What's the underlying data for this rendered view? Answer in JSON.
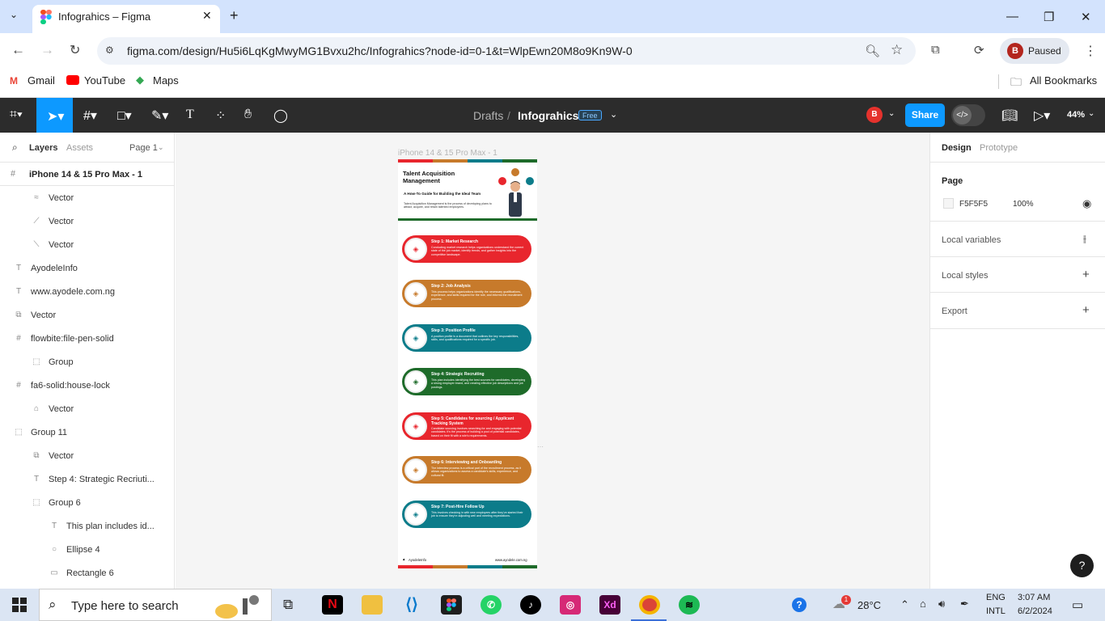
{
  "browser": {
    "tab_title": "Infograhics – Figma",
    "new_tab": "+",
    "url": "figma.com/design/Hu5i6LqKgMwyMG1Bvxu2hc/Infograhics?node-id=0-1&t=WlpEwn20M8o9Kn9W-0",
    "profile_initial": "B",
    "profile_status": "Paused",
    "bookmarks": [
      "Gmail",
      "YouTube",
      "Maps"
    ],
    "all_bookmarks": "All Bookmarks"
  },
  "figma": {
    "breadcrumb_drafts": "Drafts",
    "breadcrumb_sep": "/",
    "file_name": "Infograhics",
    "plan_badge": "Free",
    "user_initial": "B",
    "share_label": "Share",
    "zoom": "44%",
    "left_tabs": {
      "layers": "Layers",
      "assets": "Assets",
      "page": "Page 1"
    },
    "frame_name": "iPhone 14 & 15 Pro Max - 1",
    "layers": [
      {
        "name": "Vector",
        "icon": "≈",
        "indent": 2
      },
      {
        "name": "Vector",
        "icon": "⟋",
        "indent": 2
      },
      {
        "name": "Vector",
        "icon": "⟍",
        "indent": 2
      },
      {
        "name": "AyodeleInfo",
        "icon": "T",
        "indent": 1
      },
      {
        "name": "www.ayodele.com.ng",
        "icon": "T",
        "indent": 1
      },
      {
        "name": "Vector",
        "icon": "⧉",
        "indent": 1
      },
      {
        "name": "flowbite:file-pen-solid",
        "icon": "#",
        "indent": 1
      },
      {
        "name": "Group",
        "icon": "⬚",
        "indent": 2
      },
      {
        "name": "fa6-solid:house-lock",
        "icon": "#",
        "indent": 1
      },
      {
        "name": "Vector",
        "icon": "⌂",
        "indent": 2
      },
      {
        "name": "Group 11",
        "icon": "⬚",
        "indent": 1
      },
      {
        "name": "Vector",
        "icon": "⧉",
        "indent": 2
      },
      {
        "name": "Step 4: Strategic Recriuti...",
        "icon": "T",
        "indent": 2
      },
      {
        "name": "Group 6",
        "icon": "⬚",
        "indent": 2
      },
      {
        "name": "This plan includes id...",
        "icon": "T",
        "indent": 3
      },
      {
        "name": "Ellipse 4",
        "icon": "○",
        "indent": 3
      },
      {
        "name": "Rectangle 6",
        "icon": "▭",
        "indent": 3
      }
    ],
    "right_tabs": {
      "design": "Design",
      "prototype": "Prototype"
    },
    "page_section": "Page",
    "page_color": "F5F5F5",
    "page_opacity": "100%",
    "local_variables": "Local variables",
    "local_styles": "Local styles",
    "export": "Export",
    "help": "?"
  },
  "infographic": {
    "frame_label": "iPhone 14 & 15 Pro Max - 1",
    "title": "Talent Acquisition Management",
    "subtitle": "A How-To Guide for Building the Ideal Team",
    "intro": "Talent Acquisition Management is the process of developing plans to attract, acquire, and retain talented employees.",
    "footer_brand": "AyodeleInfo",
    "footer_url": "www.ayodele.com.ng",
    "steps": [
      {
        "title": "Step 1: Market Research",
        "desc": "Conducting market research helps organizations understand the current state of the job market, identify trends, and gather insights into the competitive landscape.",
        "color": "#e8262d"
      },
      {
        "title": "Step 2: Job Analysis",
        "desc": "This process helps organizations identify the necessary qualifications, experience, and skills required for the role, and informs the recruitment process.",
        "color": "#c77a2b"
      },
      {
        "title": "Step 3: Position Profile",
        "desc": "A position profile is a document that outlines the key responsibilities, skills, and qualifications required for a specific job.",
        "color": "#0c7c8a"
      },
      {
        "title": "Step 4: Strategic Recruiting",
        "desc": "This plan includes identifying the best sources for candidates, developing a strong employer brand, and creating effective job descriptions and job postings.",
        "color": "#1e6b2a"
      },
      {
        "title": "Step 5: Candidates for sourcing / Applicant Tracking System",
        "desc": "Candidate sourcing involves searching for and engaging with potential candidates. It's the process of building a pool of potential candidates, based on their fit with a role's requirements.",
        "color": "#e8262d"
      },
      {
        "title": "Step 6: Interviewing and Onboarding",
        "desc": "The interview process is a critical part of the recruitment process, as it allows organizations to assess a candidate's skills, experience, and cultural fit.",
        "color": "#c77a2b"
      },
      {
        "title": "Step 7: Post-Hire Follow Up",
        "desc": "This involves checking in with new employees after they've started their job to ensure they're adjusting well and meeting expectations.",
        "color": "#0c7c8a"
      }
    ]
  },
  "taskbar": {
    "search_placeholder": "Type here to search",
    "weather": "28°C",
    "lang1": "ENG",
    "lang2": "INTL",
    "time": "3:07 AM",
    "date": "6/2/2024",
    "weather_badge": "1"
  }
}
